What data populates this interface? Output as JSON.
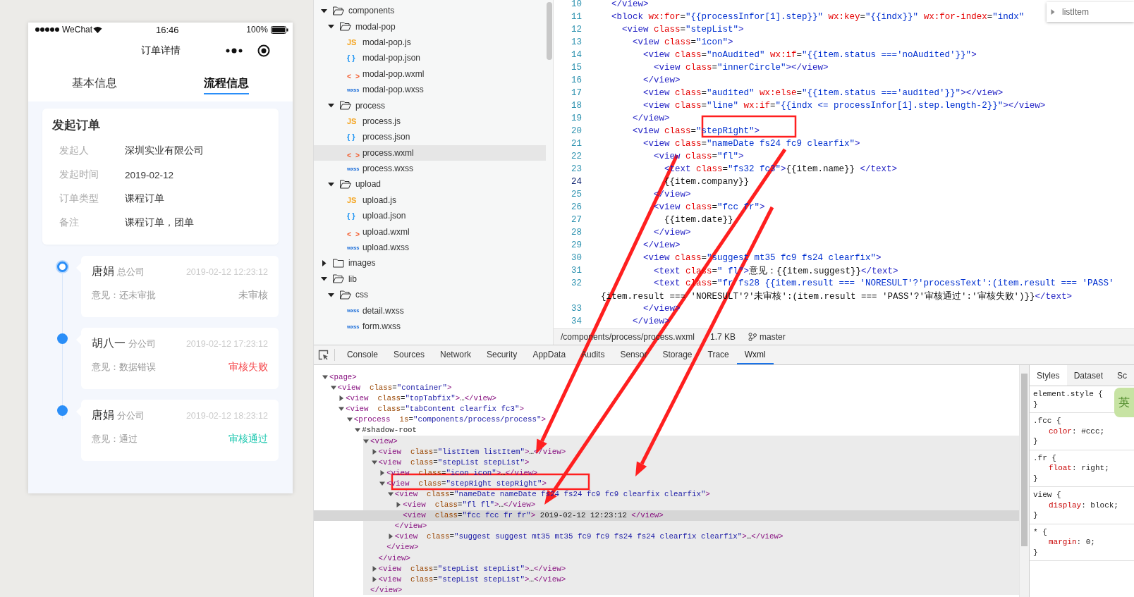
{
  "phone": {
    "status_bar": {
      "carrier": "WeChat",
      "time": "16:46",
      "battery": "100%"
    },
    "nav_title": "订单详情",
    "tabs": [
      {
        "label": "基本信息",
        "selected": false
      },
      {
        "label": "流程信息",
        "selected": true
      }
    ],
    "order_card": {
      "title": "发起订单",
      "fields": [
        {
          "label": "发起人",
          "value": "深圳实业有限公司"
        },
        {
          "label": "发起时间",
          "value": "2019-02-12"
        },
        {
          "label": "订单类型",
          "value": "课程订单"
        },
        {
          "label": "备注",
          "value": "课程订单，团单"
        }
      ]
    },
    "steps": [
      {
        "name": "唐娟",
        "company": "总公司",
        "date": "2019-02-12 12:23:12",
        "opinion": "意见：还未审批",
        "result": "未审核",
        "color": "#999999",
        "audited": false
      },
      {
        "name": "胡八一",
        "company": "分公司",
        "date": "2019-02-12 17:23:12",
        "opinion": "意见：数据错误",
        "result": "审核失败",
        "color": "#f5484c",
        "audited": true
      },
      {
        "name": "唐娟",
        "company": "分公司",
        "date": "2019-02-12 18:23:12",
        "opinion": "意见：通过",
        "result": "审核通过",
        "color": "#1ec8b0",
        "audited": true
      }
    ]
  },
  "file_tree": [
    {
      "name": "components",
      "kind": "folder",
      "expanded": true,
      "selected": false,
      "children": [
        {
          "name": "modal-pop",
          "kind": "folder",
          "expanded": true,
          "selected": false,
          "children": [
            {
              "name": "modal-pop.js",
              "kind": "js",
              "badge": "JS",
              "selected": false
            },
            {
              "name": "modal-pop.json",
              "kind": "json",
              "badge": "{ }",
              "selected": false
            },
            {
              "name": "modal-pop.wxml",
              "kind": "wxml",
              "badge": "< >",
              "selected": false
            },
            {
              "name": "modal-pop.wxss",
              "kind": "wxss",
              "badge": "wxss",
              "selected": false
            }
          ]
        },
        {
          "name": "process",
          "kind": "folder",
          "expanded": true,
          "selected": false,
          "children": [
            {
              "name": "process.js",
              "kind": "js",
              "badge": "JS",
              "selected": false
            },
            {
              "name": "process.json",
              "kind": "json",
              "badge": "{ }",
              "selected": false
            },
            {
              "name": "process.wxml",
              "kind": "wxml",
              "badge": "< >",
              "selected": true
            },
            {
              "name": "process.wxss",
              "kind": "wxss",
              "badge": "wxss",
              "selected": false
            }
          ]
        },
        {
          "name": "upload",
          "kind": "folder",
          "expanded": true,
          "selected": false,
          "children": [
            {
              "name": "upload.js",
              "kind": "js",
              "badge": "JS",
              "selected": false
            },
            {
              "name": "upload.json",
              "kind": "json",
              "badge": "{ }",
              "selected": false
            },
            {
              "name": "upload.wxml",
              "kind": "wxml",
              "badge": "< >",
              "selected": false
            },
            {
              "name": "upload.wxss",
              "kind": "wxss",
              "badge": "wxss",
              "selected": false
            }
          ]
        }
      ]
    },
    {
      "name": "images",
      "kind": "folder",
      "expanded": false,
      "selected": false
    },
    {
      "name": "lib",
      "kind": "folder",
      "expanded": true,
      "selected": false,
      "children": [
        {
          "name": "css",
          "kind": "folder",
          "expanded": true,
          "selected": false,
          "children": [
            {
              "name": "detail.wxss",
              "kind": "wxss",
              "badge": "wxss",
              "selected": false
            },
            {
              "name": "form.wxss",
              "kind": "wxss",
              "badge": "wxss",
              "selected": false
            }
          ]
        }
      ]
    }
  ],
  "editor": {
    "lines": [
      {
        "n": "10",
        "code": "  </view>",
        "current": false
      },
      {
        "n": "11",
        "code": "  <block wx:for=\"{{processInfor[1].step}}\" wx:key=\"{{indx}}\" wx:for-index=\"indx\"",
        "current": false
      },
      {
        "n": "12",
        "code": "    <view class=\"stepList\">",
        "current": false
      },
      {
        "n": "13",
        "code": "      <view class=\"icon\">",
        "current": false
      },
      {
        "n": "14",
        "code": "        <view class=\"noAudited\" wx:if=\"{{item.status ==='noAudited'}}\">",
        "current": false
      },
      {
        "n": "15",
        "code": "          <view class=\"innerCircle\"></view>",
        "current": false
      },
      {
        "n": "16",
        "code": "        </view>",
        "current": false
      },
      {
        "n": "17",
        "code": "        <view class=\"audited\" wx:else=\"{{item.status ==='audited'}}\"></view>",
        "current": false
      },
      {
        "n": "18",
        "code": "        <view class=\"line\" wx:if=\"{{indx <= processInfor[1].step.length-2}}\"></view>",
        "current": false
      },
      {
        "n": "19",
        "code": "      </view>",
        "current": false
      },
      {
        "n": "20",
        "code": "      <view class=\"stepRight\">",
        "current": false
      },
      {
        "n": "21",
        "code": "        <view class=\"nameDate fs24 fc9 clearfix\">",
        "current": false
      },
      {
        "n": "22",
        "code": "          <view class=\"fl\">",
        "current": false
      },
      {
        "n": "23",
        "code": "            <text class=\"fs32 fc3\">{{item.name}} </text>",
        "current": false
      },
      {
        "n": "24",
        "code": "            {{item.company}}",
        "current": true
      },
      {
        "n": "25",
        "code": "          </view>",
        "current": false
      },
      {
        "n": "26",
        "code": "          <view class=\"fcc fr\">",
        "current": false
      },
      {
        "n": "27",
        "code": "            {{item.date}}",
        "current": false
      },
      {
        "n": "28",
        "code": "          </view>",
        "current": false
      },
      {
        "n": "29",
        "code": "        </view>",
        "current": false
      },
      {
        "n": "30",
        "code": "        <view class=\"suggest mt35 fc9 fs24 clearfix\">",
        "current": false
      },
      {
        "n": "31",
        "code": "          <text class=\" fl\">意见：{{item.suggest}}</text>",
        "current": false
      },
      {
        "n": "32",
        "code": "          <text class=\"fr fs28 {{item.result === 'NORESULT'?'processText':(item.result === 'PASS'",
        "wrap": "{item.result === 'NORESULT'?'未审核':(item.result === 'PASS'?'审核通过':'审核失败')}}</text>",
        "current": false
      },
      {
        "n": "33",
        "code": "        </view>",
        "current": false
      },
      {
        "n": "34",
        "code": "      </view>",
        "current": false
      }
    ],
    "search": {
      "value": "listItem"
    },
    "status_bar": {
      "path": "/components/process/process.wxml",
      "size": "1.7 KB",
      "branch": "master"
    }
  },
  "devtools": {
    "tabs": [
      {
        "label": "Console",
        "selected": false
      },
      {
        "label": "Sources",
        "selected": false
      },
      {
        "label": "Network",
        "selected": false
      },
      {
        "label": "Security",
        "selected": false
      },
      {
        "label": "AppData",
        "selected": false
      },
      {
        "label": "Audits",
        "selected": false
      },
      {
        "label": "Sensor",
        "selected": false
      },
      {
        "label": "Storage",
        "selected": false
      },
      {
        "label": "Trace",
        "selected": false
      },
      {
        "label": "Wxml",
        "selected": true
      }
    ],
    "wxml": [
      {
        "tag": "<page>",
        "expanded": true,
        "selected": false,
        "highlighted": false,
        "children": [
          {
            "tag": "<view  class=\"container\">",
            "expanded": true,
            "selected": false,
            "highlighted": false,
            "children": [
              {
                "tag": "<view  class=\"topTabfix\">…</view>",
                "expanded": false,
                "selected": false,
                "highlighted": false
              },
              {
                "tag": "<view  class=\"tabContent clearfix fc3\">",
                "expanded": true,
                "selected": false,
                "highlighted": false,
                "children": [
                  {
                    "tag": "<process  is=\"components/process/process\">",
                    "expanded": true,
                    "selected": false,
                    "highlighted": false,
                    "children": [
                      {
                        "tag": "#shadow-root",
                        "expanded": true,
                        "selected": false,
                        "highlighted": false,
                        "children": [
                          {
                            "tag": "<view>",
                            "expanded": true,
                            "selected": false,
                            "highlighted": true,
                            "close": "</view>",
                            "children": [
                              {
                                "tag": "<view  class=\"listItem listItem\">…</view>",
                                "expanded": false,
                                "selected": false,
                                "highlighted": false
                              },
                              {
                                "tag": "<view  class=\"stepList stepList\">",
                                "expanded": true,
                                "selected": false,
                                "highlighted": false,
                                "close": "</view>",
                                "children": [
                                  {
                                    "tag": "<view  class=\"icon icon\">…</view>",
                                    "expanded": false,
                                    "selected": false,
                                    "highlighted": false
                                  },
                                  {
                                    "tag": "<view  class=\"stepRight stepRight\">",
                                    "expanded": true,
                                    "selected": false,
                                    "highlighted": false,
                                    "close": "</view>",
                                    "children": [
                                      {
                                        "tag": "<view  class=\"nameDate nameDate fs24 fs24 fc9 fc9 clearfix clearfix\">",
                                        "expanded": true,
                                        "selected": false,
                                        "highlighted": false,
                                        "close": "</view>",
                                        "children": [
                                          {
                                            "tag": "<view  class=\"fl fl\">…</view>",
                                            "expanded": false,
                                            "selected": false,
                                            "highlighted": false
                                          },
                                          {
                                            "tag": "<view  class=\"fcc fcc fr fr\"> 2019-02-12 12:23:12 </view>",
                                            "selected": true,
                                            "highlighted": false
                                          }
                                        ]
                                      },
                                      {
                                        "tag": "<view  class=\"suggest suggest mt35 mt35 fc9 fc9 fs24 fs24 clearfix clearfix\">…</view>",
                                        "expanded": false,
                                        "selected": false,
                                        "highlighted": false
                                      }
                                    ]
                                  }
                                ]
                              },
                              {
                                "tag": "<view  class=\"stepList stepList\">…</view>",
                                "expanded": false,
                                "selected": false,
                                "highlighted": false
                              },
                              {
                                "tag": "<view  class=\"stepList stepList\">…</view>",
                                "expanded": false,
                                "selected": false,
                                "highlighted": false
                              }
                            ]
                          }
                        ]
                      }
                    ]
                  }
                ]
              }
            ]
          }
        ]
      }
    ],
    "side_tabs": [
      {
        "label": "Styles",
        "selected": true
      },
      {
        "label": "Dataset",
        "selected": false
      },
      {
        "label": "Sc",
        "selected": false
      }
    ],
    "rules": [
      {
        "selector": "element.style {",
        "close": "}"
      },
      {
        "selector": ".fcc {",
        "decls": [
          "color: #ccc;"
        ],
        "close": "}"
      },
      {
        "selector": ".fr {",
        "decls": [
          "float: right;"
        ],
        "close": "}"
      },
      {
        "selector": "view {",
        "decls": [
          "display: block;"
        ],
        "close": "}"
      },
      {
        "selector": "* {",
        "decls": [
          "margin: 0;"
        ],
        "close": "}"
      }
    ],
    "ime_badge": "英"
  }
}
